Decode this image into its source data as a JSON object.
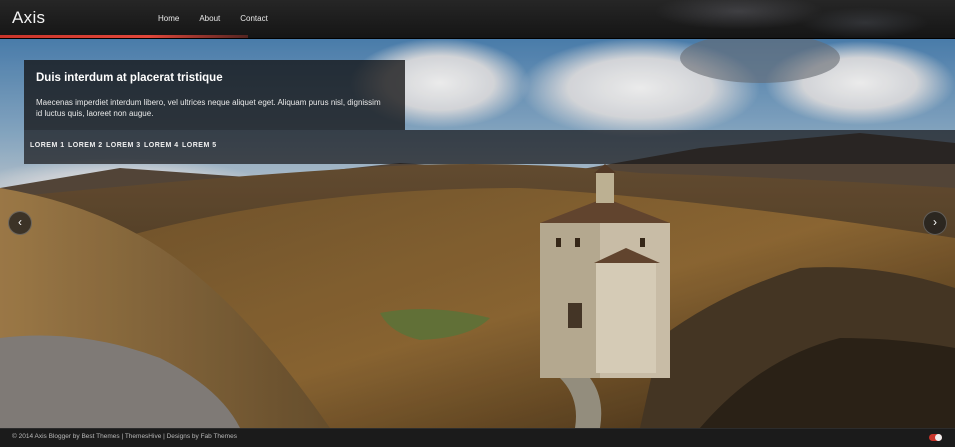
{
  "header": {
    "brand": "Axis",
    "nav": [
      {
        "label": "Home"
      },
      {
        "label": "About"
      },
      {
        "label": "Contact"
      }
    ]
  },
  "slider": {
    "caption_title": "Duis interdum at placerat tristique",
    "caption_text": "Maecenas imperdiet interdum libero, vel ultrices neque aliquet eget. Aliquam purus nisl, dignissim id luctus quis, laoreet non augue.",
    "thumbnails": [
      {
        "label": "LOREM 1"
      },
      {
        "label": "LOREM 2"
      },
      {
        "label": "LOREM 3"
      },
      {
        "label": "LOREM 4"
      },
      {
        "label": "LOREM 5"
      }
    ],
    "prev_glyph": "‹",
    "next_glyph": "›"
  },
  "footer": {
    "text": "© 2014 Axis Blogger by Best Themes | ThemesHive | Designs by Fab Themes"
  },
  "colors": {
    "accent": "#c8342a",
    "header_bg": "#1c1c1c"
  }
}
